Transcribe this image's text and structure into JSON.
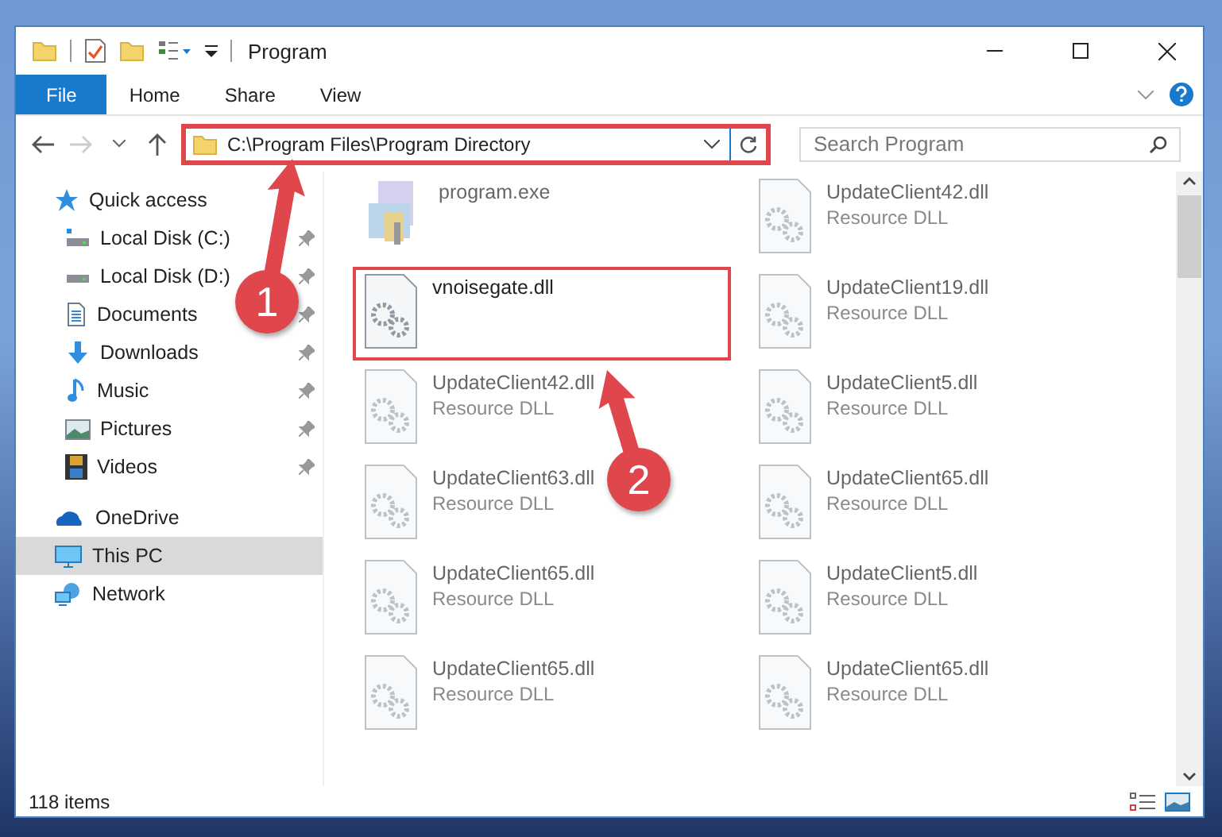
{
  "window": {
    "title": "Program"
  },
  "ribbon": {
    "tabs": [
      {
        "label": "File",
        "kind": "menu"
      },
      {
        "label": "Home",
        "kind": "tab"
      },
      {
        "label": "Share",
        "kind": "tab"
      },
      {
        "label": "View",
        "kind": "tab"
      }
    ]
  },
  "address": {
    "path": "C:\\Program Files\\Program Directory",
    "highlighted": true
  },
  "search": {
    "placeholder": "Search Program"
  },
  "sidebar": {
    "items": [
      {
        "label": "Quick access",
        "selected": false,
        "children": [
          {
            "label": "Local Disk (C:)",
            "pinned": true,
            "selected": false
          },
          {
            "label": "Local Disk (D:)",
            "pinned": true,
            "selected": false
          },
          {
            "label": "Documents",
            "pinned": true,
            "selected": false
          },
          {
            "label": "Downloads",
            "pinned": true,
            "selected": false
          },
          {
            "label": "Music",
            "pinned": true,
            "selected": false
          },
          {
            "label": "Pictures",
            "pinned": true,
            "selected": false
          },
          {
            "label": "Videos",
            "pinned": true,
            "selected": false
          }
        ]
      },
      {
        "label": "OneDrive",
        "selected": false
      },
      {
        "label": "This PC",
        "selected": true
      },
      {
        "label": "Network",
        "selected": false
      }
    ]
  },
  "files": [
    {
      "name": "program.exe",
      "kind": "exe",
      "blurred": true,
      "highlighted": false
    },
    {
      "name": "UpdateClient42.dll",
      "type": "Resource DLL",
      "kind": "dll",
      "blurred": true,
      "highlighted": false
    },
    {
      "name": "vnoisegate.dll",
      "kind": "dll",
      "blurred": false,
      "highlighted": true
    },
    {
      "name": "UpdateClient19.dll",
      "type": "Resource DLL",
      "kind": "dll",
      "blurred": true,
      "highlighted": false
    },
    {
      "name": "UpdateClient42.dll",
      "type": "Resource DLL",
      "kind": "dll",
      "blurred": true,
      "highlighted": false
    },
    {
      "name": "UpdateClient5.dll",
      "type": "Resource DLL",
      "kind": "dll",
      "blurred": true,
      "highlighted": false
    },
    {
      "name": "UpdateClient63.dll",
      "type": "Resource DLL",
      "kind": "dll",
      "blurred": true,
      "highlighted": false
    },
    {
      "name": "UpdateClient65.dll",
      "type": "Resource DLL",
      "kind": "dll",
      "blurred": true,
      "highlighted": false
    },
    {
      "name": "UpdateClient65.dll",
      "type": "Resource DLL",
      "kind": "dll",
      "blurred": true,
      "highlighted": false
    },
    {
      "name": "UpdateClient5.dll",
      "type": "Resource DLL",
      "kind": "dll",
      "blurred": true,
      "highlighted": false
    },
    {
      "name": "UpdateClient65.dll",
      "type": "Resource DLL",
      "kind": "dll",
      "blurred": true,
      "highlighted": false
    },
    {
      "name": "UpdateClient65.dll",
      "type": "Resource DLL",
      "kind": "dll",
      "blurred": true,
      "highlighted": false
    }
  ],
  "status_bar": {
    "count": "118 items"
  },
  "callouts": [
    {
      "label": "1"
    },
    {
      "label": "2"
    }
  ]
}
